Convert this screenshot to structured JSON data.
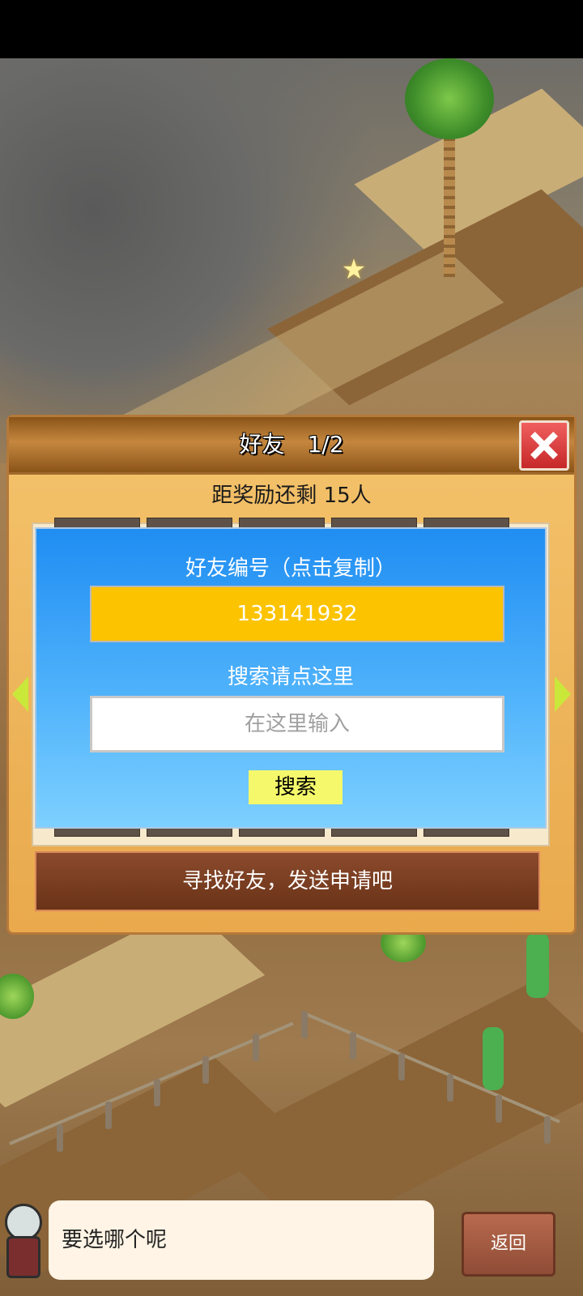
{
  "dialog": {
    "title": "好友　1/2",
    "reward_text": "距奖励还剩 15人",
    "friend_id_label": "好友编号（点击复制）",
    "friend_id": "133141932",
    "search_label": "搜索请点这里",
    "search_placeholder": "在这里输入",
    "search_button": "搜索",
    "find_friends_banner": "寻找好友，发送申请吧"
  },
  "bottom": {
    "speech": "要选哪个呢",
    "back_label": "返回"
  }
}
